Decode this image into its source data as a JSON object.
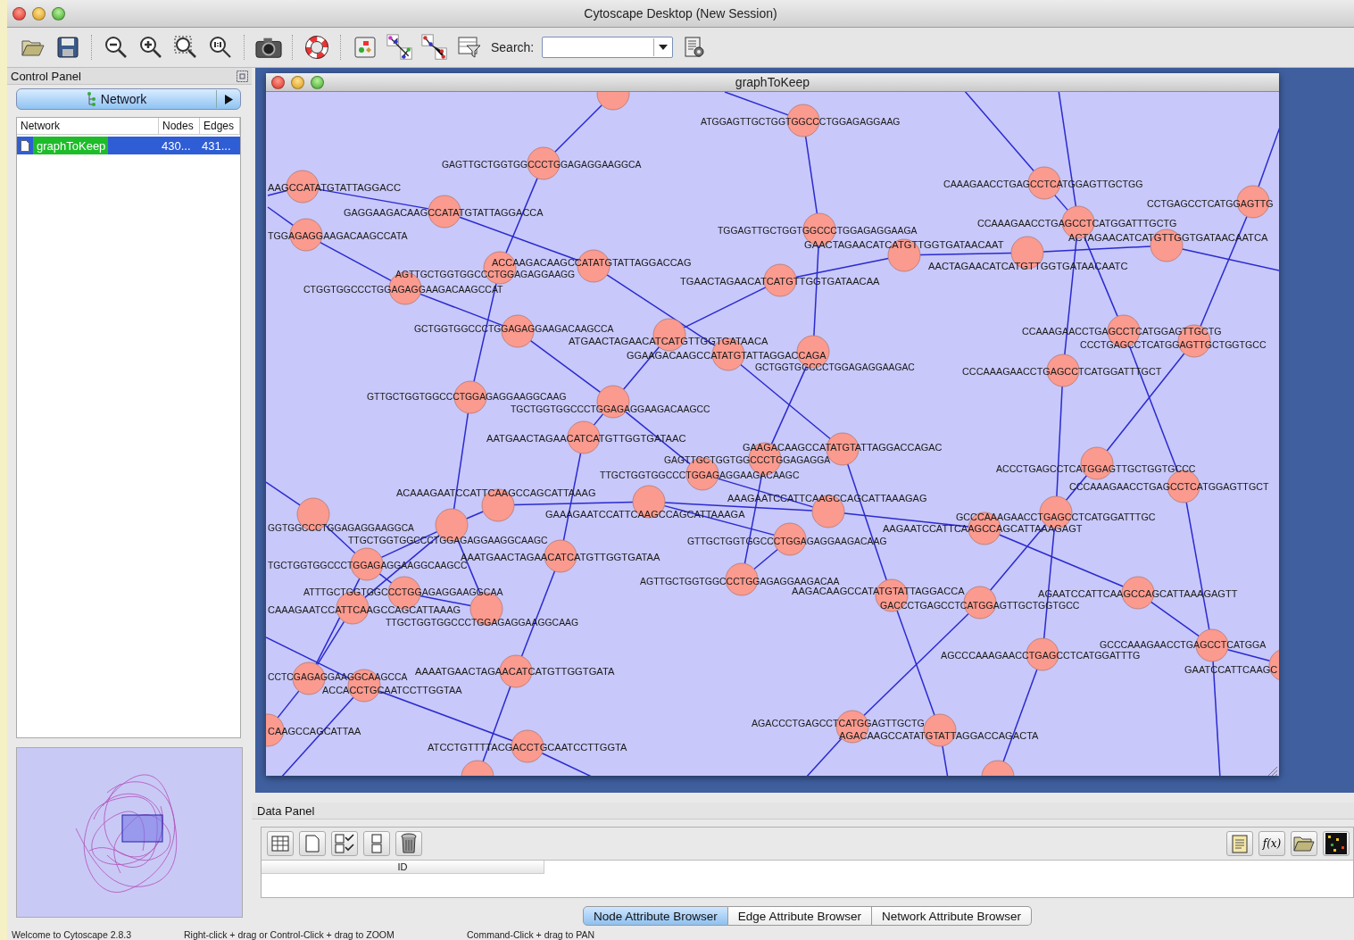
{
  "window": {
    "title": "Cytoscape Desktop (New Session)"
  },
  "toolbar": {
    "search": {
      "label": "Search:"
    }
  },
  "control_panel": {
    "title": "Control Panel",
    "tab": {
      "label": "Network"
    },
    "network_table": {
      "columns": [
        "Network",
        "Nodes",
        "Edges"
      ],
      "rows": [
        {
          "network": "graphToKeep",
          "nodes": "430...",
          "edges": "431...",
          "selected": true
        }
      ]
    }
  },
  "network_view": {
    "title": "graphToKeep",
    "nodes": [
      {
        "kind": "node"
      },
      {
        "kind": "node",
        "label": "ATGGAGTTGCTGGTGGCCCTGGAGAGGAAG"
      },
      {
        "kind": "node",
        "label": "GAGTTGCTGGTGGCCCTGGAGAGGAAGGCA"
      },
      {
        "kind": "node",
        "label": "AAGCCATATGTATTAGGACC"
      },
      {
        "kind": "node",
        "label": "GAGGAAGACAAGCCATATGTATTAGGACCA"
      },
      {
        "kind": "node",
        "label": "TGGAGAGGAAGACAAGCCATA"
      },
      {
        "kind": "node",
        "label": "CAAAGAACCTGAGCCTCATGGAGTTGCTGG"
      },
      {
        "kind": "node",
        "label": "CCTGAGCCTCATGGAGTTG"
      },
      {
        "kind": "node",
        "label": "TGGAGTTGCTGGTGGCCCTGGAGAGGAAGA"
      },
      {
        "kind": "node",
        "label": "CCAAAGAACCTGAGCCTCATGGATTTGCTG"
      },
      {
        "kind": "node",
        "label": "GAACTAGAACATCATGTTGGTGATAACAAT"
      },
      {
        "kind": "node",
        "label": "AACTAGAACATCATGTTGGTGATAACAATC"
      },
      {
        "kind": "node",
        "label": "ACTAGAACATCATGTTGGTGATAACAATCA"
      },
      {
        "kind": "node",
        "label": "AGTTGCTGGTGGCCCTGGAGAGGAAGG"
      },
      {
        "kind": "node",
        "label": "ACCAAGACAAGCCATATGTATTAGGACCAG"
      },
      {
        "kind": "node",
        "label": "CTGGTGGCCCTGGAGAGGAAGACAAGCCAT"
      },
      {
        "kind": "node",
        "label": "TGAACTAGAACATCATGTTGGTGATAACAA"
      },
      {
        "kind": "node",
        "label": "GCTGGTGGCCCTGGAGAGGAAGACAAGCCA"
      },
      {
        "kind": "node",
        "label": "ATGAACTAGAACATCATGTTGGTGATAACA"
      },
      {
        "kind": "node",
        "label": "GGAAGACAAGCCATATGTATTAGGACCAGA"
      },
      {
        "kind": "node",
        "label": "GCTGGTGGCCCTGGAGAGGAAGAC"
      },
      {
        "kind": "node",
        "label": "CCAAAGAACCTGAGCCTCATGGAGTTGCTG"
      },
      {
        "kind": "node",
        "label": "CCCTGAGCCTCATGGAGTTGCTGGTGCC"
      },
      {
        "kind": "node",
        "label": "CCCAAAGAACCTGAGCCTCATGGATTTGCT"
      },
      {
        "kind": "node",
        "label": "GTTGCTGGTGGCCCTGGAGAGGAAGGCAAG"
      },
      {
        "kind": "node",
        "label": "TGCTGGTGGCCCTGGAGAGGAAGACAAGCC"
      },
      {
        "kind": "node",
        "label": "AATGAACTAGAACATCATGTTGGTGATAAC"
      },
      {
        "kind": "node",
        "label": "GAAGACAAGCCATATGTATTAGGACCAGAC"
      },
      {
        "kind": "node",
        "label": "GAGTTGCTGGTGGCCCTGGAGAGGA"
      },
      {
        "kind": "node",
        "label": "TTGCTGGTGGCCCTGGAGAGGAAGACAAGC"
      },
      {
        "kind": "node",
        "label": "ACCCTGAGCCTCATGGAGTTGCTGGTGCCC"
      },
      {
        "kind": "node",
        "label": "CCCAAAGAACCTGAGCCTCATGGAGTTGCT"
      },
      {
        "kind": "node",
        "label": "GGTGGCCCTGGAGAGGAAGGCA"
      },
      {
        "kind": "node",
        "label": "ACAAAGAATCCATTCAAGCCAGCATTAAAG"
      },
      {
        "kind": "node",
        "label": "TTGCTGGTGGCCCTGGAGAGGAAGGCAAGC"
      },
      {
        "kind": "node",
        "label": "GAAAGAATCCATTCAAGCCAGCATTAAAGA"
      },
      {
        "kind": "node",
        "label": "AAAGAATCCATTCAAGCCAGCATTAAAGAG"
      },
      {
        "kind": "node",
        "label": "GCCCAAAGAACCTGAGCCTCATGGATTTGC"
      },
      {
        "kind": "node",
        "label": "AAGAATCCATTCAAGCCAGCATTAAAGAGT"
      },
      {
        "kind": "node",
        "label": "GTTGCTGGTGGCCCTGGAGAGGAAGACAAG"
      },
      {
        "kind": "node",
        "label": "TGCTGGTGGCCCTGGAGAGGAAGGCAAGCC"
      },
      {
        "kind": "node",
        "label": "AAATGAACTAGAACATCATGTTGGTGATAA"
      },
      {
        "kind": "node",
        "label": "ATTTGCTGGTGGCCCTGGAGAGGAAGGCAA"
      },
      {
        "kind": "node",
        "label": "CAAAGAATCCATTCAAGCCAGCATTAAAG"
      },
      {
        "kind": "node",
        "label": "TTGCTGGTGGCCCTGGAGAGGAAGGCAAG"
      },
      {
        "kind": "node",
        "label": "AGTTGCTGGTGGCCCTGGAGAGGAAGACAA"
      },
      {
        "kind": "node",
        "label": "AAGACAAGCCATATGTATTAGGACCA"
      },
      {
        "kind": "node",
        "label": "GACCCTGAGCCTCATGGAGTTGCTGGTGCC"
      },
      {
        "kind": "node",
        "label": "AGAATCCATTCAAGCCAGCATTAAAGAGTT"
      },
      {
        "kind": "node",
        "label": "AGCCCAAAGAACCTGAGCCTCATGGATTTG"
      },
      {
        "kind": "node",
        "label": "GCCCAAAGAACCTGAGCCTCATGGA"
      },
      {
        "kind": "node",
        "label": "GAATCCATTCAAGC"
      },
      {
        "kind": "node",
        "label": "CCTCGAGAGGAAGGCAAGCCA"
      },
      {
        "kind": "node",
        "label": "ACCACCTGCAATCCTTGGTAA"
      },
      {
        "kind": "node",
        "label": "AAAATGAACTAGAACATCATGTTGGTGATA"
      },
      {
        "kind": "node",
        "label": "CAAGCCAGCATTAA"
      },
      {
        "kind": "node",
        "label": "AGACCCTGAGCCTCATGGAGTTGCTG"
      },
      {
        "kind": "node",
        "label": "AGACAAGCCATATGTATTAGGACCAGACTA"
      },
      {
        "kind": "node",
        "label": "ATCCTGTTTTACGACCTGCAATCCTTGGTA"
      },
      {
        "kind": "node"
      },
      {
        "kind": "node"
      }
    ]
  },
  "data_panel": {
    "title": "Data Panel",
    "function_button": {
      "label": "f(x)"
    },
    "table": {
      "columns": [
        "ID"
      ]
    },
    "tabs": [
      {
        "label": "Node Attribute Browser",
        "selected": true
      },
      {
        "label": "Edge Attribute Browser",
        "selected": false
      },
      {
        "label": "Network Attribute Browser",
        "selected": false
      }
    ]
  },
  "status_bar": [
    "Welcome to Cytoscape 2.8.3",
    "Right-click + drag or Control-Click + drag to ZOOM",
    "Command-Click + drag to PAN"
  ]
}
